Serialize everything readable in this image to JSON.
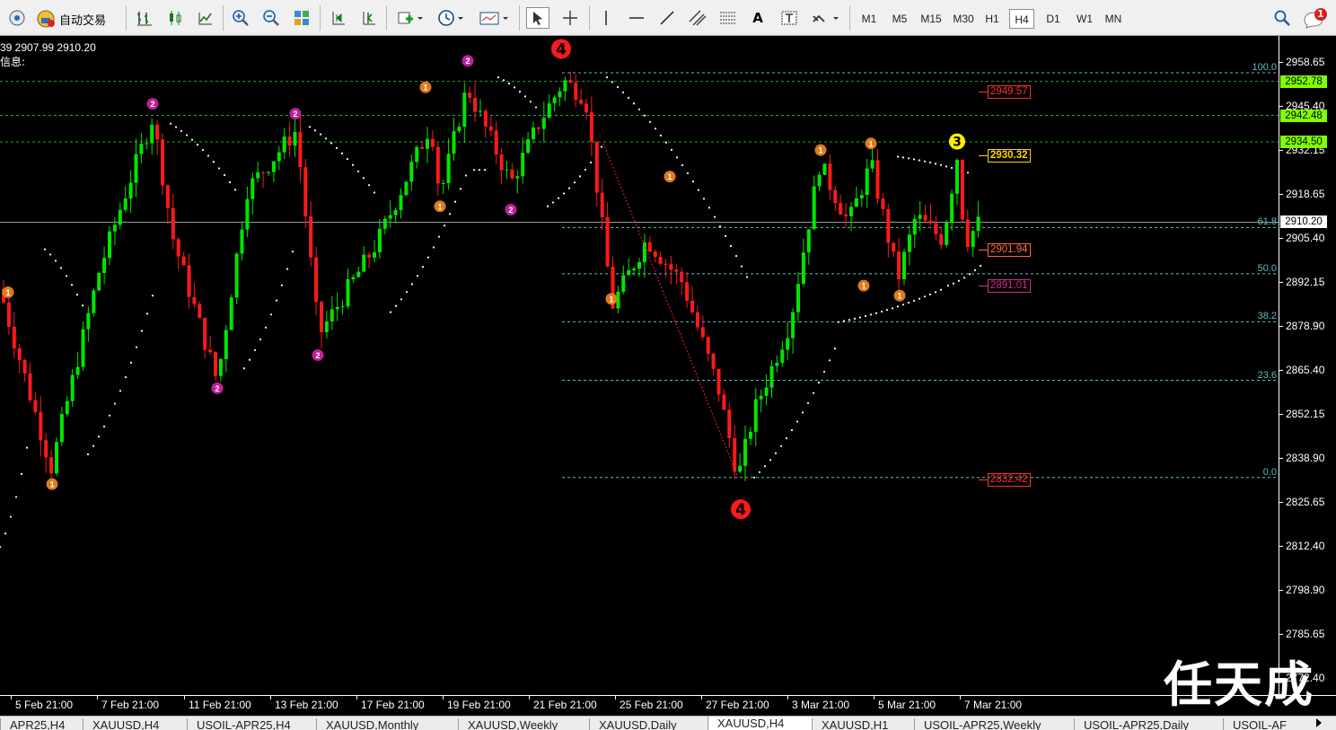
{
  "toolbar": {
    "autotrade_label": "自动交易",
    "timeframes": [
      "M1",
      "M5",
      "M15",
      "M30",
      "H1",
      "H4",
      "D1",
      "W1",
      "MN"
    ],
    "active_timeframe": "H4",
    "notification_count": "1"
  },
  "header": {
    "ohlc": "39 2907.99 2910.20",
    "info_label": "信息:"
  },
  "price_axis": {
    "ticks": [
      "2958.65",
      "2945.40",
      "2932.15",
      "2918.65",
      "2905.40",
      "2892.15",
      "2878.90",
      "2865.40",
      "2852.15",
      "2838.90",
      "2825.65",
      "2812.40",
      "2798.90",
      "2785.65",
      "2772.40"
    ],
    "price_tags": [
      {
        "value": "2952.78",
        "color": "#7fff00",
        "text_color": "#000"
      },
      {
        "value": "2942.48",
        "color": "#7fff00",
        "text_color": "#000"
      },
      {
        "value": "2934.50",
        "color": "#7fff00",
        "text_color": "#000"
      },
      {
        "value": "2910.20",
        "color": "#ffffff",
        "text_color": "#000"
      }
    ]
  },
  "fib_levels": [
    {
      "label": "100.0",
      "price": 2955.4
    },
    {
      "label": "61.8",
      "price": 2908.6
    },
    {
      "label": "50.0",
      "price": 2894.6
    },
    {
      "label": "38.2",
      "price": 2880.1
    },
    {
      "label": "23.6",
      "price": 2862.4
    },
    {
      "label": "0.0",
      "price": 2833.0
    }
  ],
  "level_labels": [
    {
      "value": "2949.57",
      "color": "#ff3030",
      "price": 2949.57
    },
    {
      "value": "2930.32",
      "color": "#ffd400",
      "price": 2930.32
    },
    {
      "value": "2901.94",
      "color": "#ff6a3a",
      "price": 2901.94
    },
    {
      "value": "2891.01",
      "color": "#d0308a",
      "price": 2891.01
    },
    {
      "value": "2832.42",
      "color": "#ff3030",
      "price": 2832.42
    }
  ],
  "time_axis": {
    "ticks": [
      "5 Feb 21:00",
      "7 Feb 21:00",
      "11 Feb 21:00",
      "13 Feb 21:00",
      "17 Feb 21:00",
      "19 Feb 21:00",
      "21 Feb 21:00",
      "25 Feb 21:00",
      "27 Feb 21:00",
      "3 Mar 21:00",
      "5 Mar 21:00",
      "7 Mar 21:00"
    ]
  },
  "wave_markers": [
    {
      "label": "4",
      "kind": "big-red"
    },
    {
      "label": "4",
      "kind": "big-red"
    },
    {
      "label": "3",
      "kind": "big-yellow"
    },
    {
      "label": "2",
      "kind": "small-magenta"
    },
    {
      "label": "1",
      "kind": "small-orange"
    }
  ],
  "tabs": [
    "APR25,H4",
    "XAUUSD,H4",
    "USOIL-APR25,H4",
    "XAUUSD,Monthly",
    "XAUUSD,Weekly",
    "XAUUSD,Daily",
    "XAUUSD,H4",
    "XAUUSD,H1",
    "USOIL-APR25,Weekly",
    "USOIL-APR25,Daily",
    "USOIL-AF"
  ],
  "active_tab_index": 6,
  "watermark": "任天成",
  "colors": {
    "bull": "#00e600",
    "bear": "#ff1a1a",
    "fib": "#5fbfbf",
    "sar": "#ffffff",
    "gridline": "#2aa52a"
  }
}
